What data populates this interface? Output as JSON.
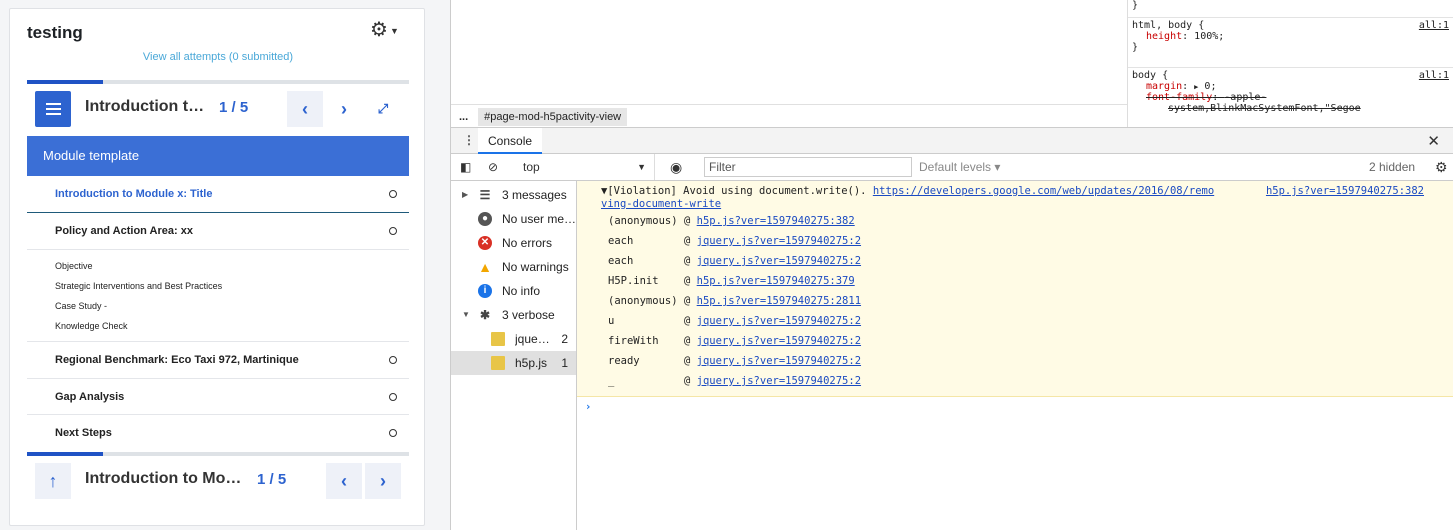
{
  "lesson": {
    "title": "testing",
    "attempts_link": "View all attempts (0 submitted)",
    "progress_fraction": 0.2,
    "top_nav": {
      "title": "Introduction to Module x: Title",
      "count": "1 / 5"
    },
    "module_header": "Module template",
    "items": [
      {
        "label": "Introduction to Module x: Title",
        "active": true
      },
      {
        "label": "Policy and Action Area: xx",
        "active": false
      },
      {
        "label": "Regional Benchmark: Eco Taxi 972, Martinique",
        "active": false
      },
      {
        "label": "Gap Analysis",
        "active": false
      },
      {
        "label": "Next Steps",
        "active": false
      }
    ],
    "subitems": [
      "Objective",
      "Strategic Interventions and Best Practices",
      "Case Study -",
      "Knowledge Check"
    ],
    "bottom_nav": {
      "title": "Introduction to Module x: Title",
      "count": "1 / 5"
    }
  },
  "devtools": {
    "breadcrumb_dots": "...",
    "breadcrumb": "#page-mod-h5pactivity-view",
    "styles": {
      "rule0_close": "}",
      "rule1_selector": "html, body {",
      "rule1_prop": "height",
      "rule1_val": "100%;",
      "rule1_close": "}",
      "rule1_link": "all:1",
      "rule2_selector": "body {",
      "rule2_prop": "margin",
      "rule2_val": "0;",
      "rule2_prop2": "font-family",
      "rule2_val2": "-apple-",
      "rule2_val2b": "system,BlinkMacSystemFont,\"Segoe",
      "rule2_link": "all:1"
    },
    "drawer_tab": "Console",
    "toolbar": {
      "context": "top",
      "filter_placeholder": "Filter",
      "levels": "Default levels ▾",
      "hidden": "2 hidden"
    },
    "sidebar": [
      {
        "label": "3 messages",
        "icon": "list-icon"
      },
      {
        "label": "No user messages",
        "icon": "user-icon"
      },
      {
        "label": "No errors",
        "icon": "error-icon",
        "color": "#d93025"
      },
      {
        "label": "No warnings",
        "icon": "warning-icon",
        "color": "#f2a600"
      },
      {
        "label": "No info",
        "icon": "info-icon",
        "color": "#1a73e8"
      },
      {
        "label": "3 verbose",
        "icon": "bug-icon"
      }
    ],
    "sidebar_files": [
      {
        "label": "jquery.js",
        "count": "2"
      },
      {
        "label": "h5p.js",
        "count": "1"
      }
    ],
    "console": {
      "violation": "▼[Violation] Avoid using document.write(). ",
      "violation_link": "https://developers.google.com/web/updates/2016/08/remo",
      "violation_link2": "ving-document-write",
      "source": "h5p.js?ver=1597940275:382",
      "frames": [
        {
          "fn": "(anonymous)",
          "src": "h5p.js?ver=1597940275:382"
        },
        {
          "fn": "each",
          "src": "jquery.js?ver=1597940275:2"
        },
        {
          "fn": "each",
          "src": "jquery.js?ver=1597940275:2"
        },
        {
          "fn": "H5P.init",
          "src": "h5p.js?ver=1597940275:379"
        },
        {
          "fn": "(anonymous)",
          "src": "h5p.js?ver=1597940275:2811"
        },
        {
          "fn": "u",
          "src": "jquery.js?ver=1597940275:2"
        },
        {
          "fn": "fireWith",
          "src": "jquery.js?ver=1597940275:2"
        },
        {
          "fn": "ready",
          "src": "jquery.js?ver=1597940275:2"
        },
        {
          "fn": "_",
          "src": "jquery.js?ver=1597940275:2"
        }
      ],
      "prompt": "›"
    }
  }
}
